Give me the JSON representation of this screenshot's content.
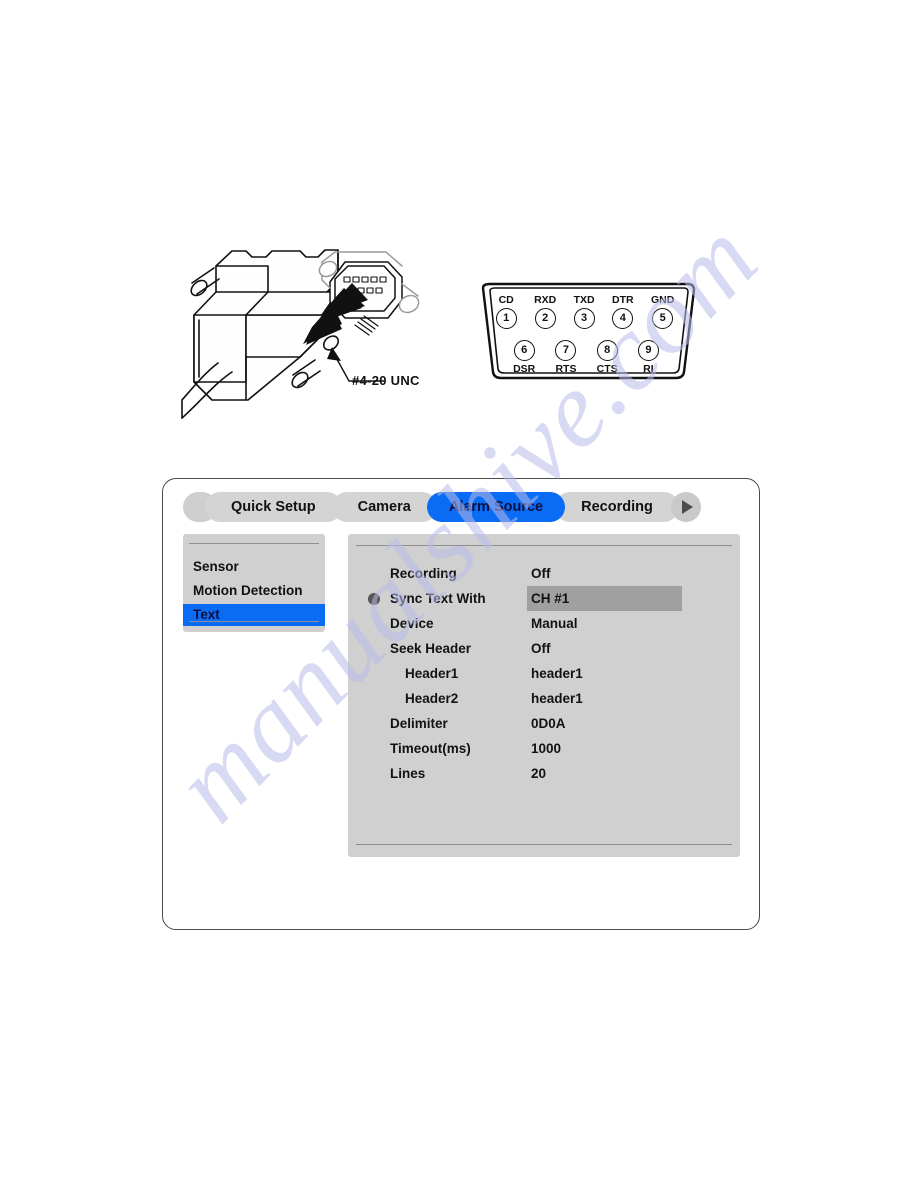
{
  "watermark": {
    "text": "manualshive.com"
  },
  "illustration": {
    "label_thread": "#4-20 UNC",
    "pinout": {
      "top_row": [
        {
          "pin": "1",
          "signal": "CD"
        },
        {
          "pin": "2",
          "signal": "RXD"
        },
        {
          "pin": "3",
          "signal": "TXD"
        },
        {
          "pin": "4",
          "signal": "DTR"
        },
        {
          "pin": "5",
          "signal": "GND"
        }
      ],
      "bottom_row": [
        {
          "pin": "6",
          "signal": "DSR"
        },
        {
          "pin": "7",
          "signal": "RTS"
        },
        {
          "pin": "8",
          "signal": "CTS"
        },
        {
          "pin": "9",
          "signal": "RI"
        }
      ]
    }
  },
  "menu": {
    "tabs": [
      {
        "label": "Quick Setup",
        "active": false
      },
      {
        "label": "Camera",
        "active": false
      },
      {
        "label": "Alarm Source",
        "active": true
      },
      {
        "label": "Recording",
        "active": false
      }
    ],
    "next_arrow": "next-arrow-icon",
    "sidebar": {
      "items": [
        {
          "label": "Sensor",
          "selected": false
        },
        {
          "label": "Motion Detection",
          "selected": false
        },
        {
          "label": "Text",
          "selected": true
        }
      ]
    },
    "settings": {
      "rows": [
        {
          "label": "Recording",
          "value": "Off",
          "indent": false,
          "bullet": false,
          "highlight": false
        },
        {
          "label": "Sync Text With",
          "value": "CH #1",
          "indent": false,
          "bullet": true,
          "highlight": true
        },
        {
          "label": "Device",
          "value": "Manual",
          "indent": false,
          "bullet": false,
          "highlight": false
        },
        {
          "label": "Seek Header",
          "value": "Off",
          "indent": false,
          "bullet": false,
          "highlight": false
        },
        {
          "label": "Header1",
          "value": "header1",
          "indent": true,
          "bullet": false,
          "highlight": false
        },
        {
          "label": "Header2",
          "value": "header1",
          "indent": true,
          "bullet": false,
          "highlight": false
        },
        {
          "label": "Delimiter",
          "value": "0D0A",
          "indent": false,
          "bullet": false,
          "highlight": false
        },
        {
          "label": "Timeout(ms)",
          "value": "1000",
          "indent": false,
          "bullet": false,
          "highlight": false
        },
        {
          "label": "Lines",
          "value": "20",
          "indent": false,
          "bullet": false,
          "highlight": false
        }
      ]
    }
  },
  "colors": {
    "accent_blue": "#0a6cf5",
    "panel_gray": "#d0d0d0",
    "tab_gray": "#d4d4d4",
    "highlight_gray": "#a0a0a0",
    "watermark_purple": "#b9bbe8"
  }
}
